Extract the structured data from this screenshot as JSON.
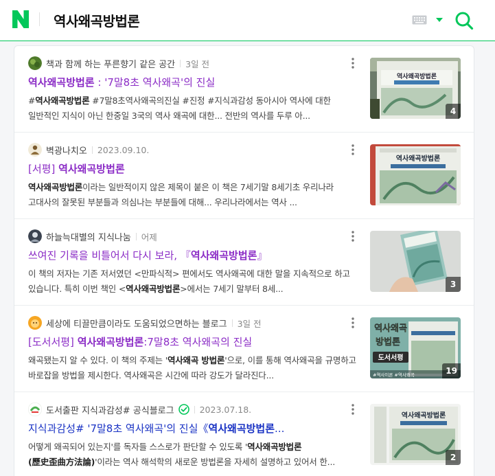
{
  "header": {
    "logo_letter": "N",
    "query": "역사왜곡방법론"
  },
  "results": [
    {
      "source": "책과 함께 하는 푸른향기 같은 공간",
      "date": "3일 전",
      "title_hl": "역사왜곡방법론",
      "title_rest": " : '7말8초 역사왜곡'의 진실",
      "desc_parts": [
        "#",
        "역사왜곡방법론",
        " #7말8초역사왜곡의진실 #진정 #지식과감성 동아시아 역사에 대한 일반적인 지식이 아닌 한중일 3국의 역사 왜곡에 대한... 전반의 역사를 두루 아..."
      ],
      "badge": "4"
    },
    {
      "source": "벽광나치오",
      "date": "2023.09.10.",
      "title_pre": "[서평] ",
      "title_hl": "역사왜곡방법론",
      "desc_parts": [
        "",
        "역사왜곡방법론",
        "이라는 일반적이지 않은 제목이 붙은 이 책은 7세기말 8세기초 우리나라 고대사의 잘못된 부분들과 의심나는 부분들에 대해... 우리나라에서는 역사 ..."
      ]
    },
    {
      "source": "하늘늑대별의 지식나눔",
      "date": "어제",
      "title_pre": "쓰여진 기록을 비틀어서 다시 보라, 『",
      "title_hl": "역사왜곡방법론",
      "title_rest": "』",
      "desc_parts": [
        "이 책의 저자는 기존 저서였던 <만파식적> 편에서도 역사왜곡에 대한 말을 지속적으로 하고 있습니다. 특히 이번 책인 <",
        "역사왜곡방법론",
        ">에서는 7세기 말부터 8세..."
      ],
      "badge": "3"
    },
    {
      "source": "세상에 티끌만큼이라도 도움되었으면하는 블로그",
      "date": "3일 전",
      "title_pre": "[도서서평] ",
      "title_hl": "역사왜곡방법론",
      "title_rest": ":7말8초 역사왜곡의 진실",
      "desc_parts": [
        "왜곡됐는지 알 수 있다. 이 책의 주제는 '",
        "역사왜곡 방법론",
        "'으로, 이를 통해 역사왜곡을 규명하고 바로잡을 방법을 제시한다. 역사왜곡은 시간에 따라 강도가 달라진다..."
      ],
      "badge": "19",
      "thumb_text": [
        "역사왜곡",
        "방법론",
        "도서서평",
        "#역사이론 #역사왜곡"
      ]
    },
    {
      "source": "도서출판 지식과감성# 공식블로그",
      "date": "2023.07.18.",
      "title_pre": "지식과감성# '7말8초 역사왜곡'의 진실《",
      "title_hl": "역사왜곡방법론",
      "title_rest": "...",
      "desc_parts": [
        "어떻게 왜곡되어 있는지'를 독자들 스스로가 판단할 수 있도록 '",
        "역사왜곡방법론(歷史歪曲方法論)",
        "'이라는 역사 해석학의 새로운 방법론을 자세히 설명하고 있어서 한..."
      ],
      "badge": "2"
    }
  ],
  "book_cover": {
    "title": "역사왜곡방법론",
    "subtitle": "'7말8초 역사왜곡'의 진실"
  },
  "colors": {
    "naver_green": "#03c75a",
    "visited_title": "#8b2cc6",
    "link_title": "#1a33c4"
  }
}
